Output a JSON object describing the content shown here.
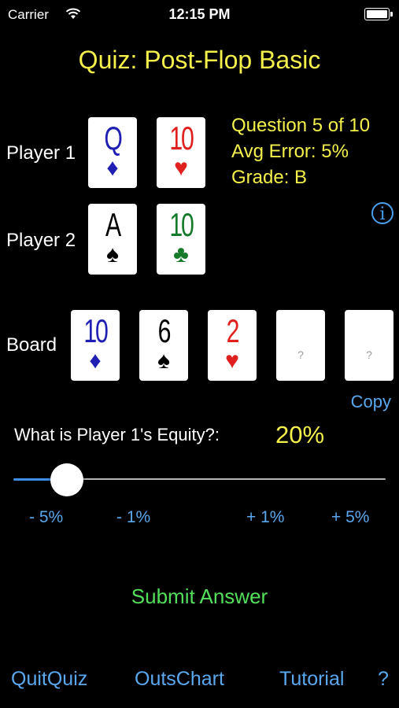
{
  "status_bar": {
    "carrier": "Carrier",
    "time": "12:15 PM"
  },
  "title": "Quiz: Post-Flop Basic",
  "players": [
    {
      "label": "Player 1",
      "cards": [
        {
          "rank": "Q",
          "suit": "♦",
          "color": "#1f1fb4"
        },
        {
          "rank": "10",
          "suit": "♥",
          "color": "#e0201e"
        }
      ]
    },
    {
      "label": "Player 2",
      "cards": [
        {
          "rank": "A",
          "suit": "♠",
          "color": "#000000"
        },
        {
          "rank": "10",
          "suit": "♣",
          "color": "#157a2a"
        }
      ]
    }
  ],
  "board": {
    "label": "Board",
    "cards": [
      {
        "rank": "10",
        "suit": "♦",
        "color": "#1f1fb4"
      },
      {
        "rank": "6",
        "suit": "♠",
        "color": "#000000"
      },
      {
        "rank": "2",
        "suit": "♥",
        "color": "#e0201e"
      },
      {
        "rank": "?",
        "suit": "",
        "color": "#9a9a9a"
      },
      {
        "rank": "?",
        "suit": "",
        "color": "#9a9a9a"
      }
    ]
  },
  "stats": {
    "question": "Question 5 of 10",
    "avg_error": "Avg Error: 5%",
    "grade": "Grade: B"
  },
  "info_icon": "i",
  "copy_label": "Copy",
  "question_prompt": "What is Player 1's Equity?:",
  "equity_value": "20%",
  "slider": {
    "value_percent": 20
  },
  "adjust": {
    "minus5": "- 5%",
    "minus1": "- 1%",
    "plus1": "+ 1%",
    "plus5": "+ 5%"
  },
  "submit_label": "Submit Answer",
  "bottom_nav": {
    "quit": "QuitQuiz",
    "outs": "OutsChart",
    "tutorial": "Tutorial",
    "help": "?"
  },
  "colors": {
    "accent_yellow": "#f5f04a",
    "link_blue": "#5aa8ee",
    "submit_green": "#52e05a",
    "slider_blue": "#3f8fe8"
  }
}
